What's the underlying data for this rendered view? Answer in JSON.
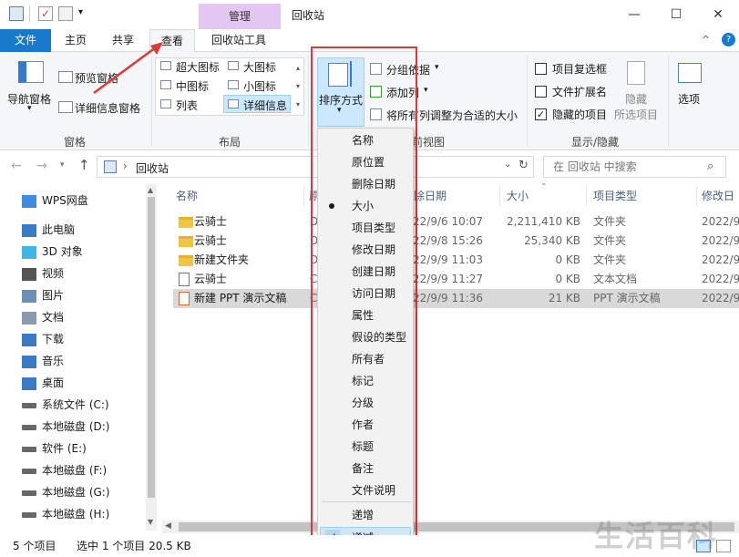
{
  "titlebar": {
    "manage_tab": "管理",
    "window_title": "回收站",
    "minimize": "—",
    "maximize": "☐",
    "close": "✕"
  },
  "tabs": {
    "file": "文件",
    "home": "主页",
    "share": "共享",
    "view": "查看",
    "recycle_tools": "回收站工具"
  },
  "ribbon": {
    "nav_pane": "导航窗格",
    "preview_pane": "预览窗格",
    "details_pane": "详细信息窗格",
    "group_panes": "窗格",
    "extra_large": "超大图标",
    "large": "大图标",
    "medium": "中图标",
    "small": "小图标",
    "list": "列表",
    "details": "详细信息",
    "group_layout": "布局",
    "sort_by": "排序方式",
    "group_by": "分组依据",
    "add_columns": "添加列",
    "size_all_columns": "将所有列调整为合适的大小",
    "group_current_view": "前视图",
    "item_checkboxes": "项目复选框",
    "file_extensions": "文件扩展名",
    "hidden_items": "隐藏的项目",
    "hide": "隐藏",
    "hide_selected": "所选项目",
    "group_show_hide": "显示/隐藏",
    "options": "选项"
  },
  "address": {
    "path": "回收站",
    "search_placeholder": "在 回收站 中搜索"
  },
  "nav_items": [
    {
      "label": "WPS网盘",
      "icon": "cloud-icon"
    },
    {
      "label": "此电脑",
      "icon": "computer-icon"
    },
    {
      "label": "3D 对象",
      "icon": "3d-objects-icon"
    },
    {
      "label": "视频",
      "icon": "video-icon"
    },
    {
      "label": "图片",
      "icon": "pictures-icon"
    },
    {
      "label": "文档",
      "icon": "documents-icon"
    },
    {
      "label": "下载",
      "icon": "download-icon"
    },
    {
      "label": "音乐",
      "icon": "music-icon"
    },
    {
      "label": "桌面",
      "icon": "desktop-icon"
    },
    {
      "label": "系统文件 (C:)",
      "icon": "drive-icon"
    },
    {
      "label": "本地磁盘 (D:)",
      "icon": "drive-icon"
    },
    {
      "label": "软件 (E:)",
      "icon": "drive-icon"
    },
    {
      "label": "本地磁盘 (F:)",
      "icon": "drive-icon"
    },
    {
      "label": "本地磁盘 (G:)",
      "icon": "drive-icon"
    },
    {
      "label": "本地磁盘 (H:)",
      "icon": "drive-icon"
    }
  ],
  "columns": {
    "name": "名称",
    "orig": "原",
    "deleted": "除日期",
    "size": "大小",
    "type": "项目类型",
    "modified": "修改日"
  },
  "files": [
    {
      "name": "云骑士",
      "orig": "D:",
      "deleted": "22/9/6 10:07",
      "size": "2,211,410 KB",
      "type": "文件夹",
      "modified": "2022/9/"
    },
    {
      "name": "云骑士",
      "orig": "D:",
      "deleted": "22/9/8 15:26",
      "size": "25,340 KB",
      "type": "文件夹",
      "modified": "2022/9/"
    },
    {
      "name": "新建文件夹",
      "orig": "D:",
      "deleted": "22/9/9 11:03",
      "size": "0 KB",
      "type": "文件夹",
      "modified": "2022/9/"
    },
    {
      "name": "云骑士",
      "orig": "C:",
      "deleted": "22/9/9 11:27",
      "size": "0 KB",
      "type": "文本文档",
      "modified": "2022/9/"
    },
    {
      "name": "新建 PPT 演示文稿",
      "orig": "C:",
      "deleted": "22/9/9 11:36",
      "size": "21 KB",
      "type": "PPT 演示文稿",
      "modified": "2022/9/"
    }
  ],
  "sort_menu": {
    "items": [
      "名称",
      "原位置",
      "删除日期",
      "大小",
      "项目类型",
      "修改日期",
      "创建日期",
      "访问日期",
      "属性",
      "假设的类型",
      "所有者",
      "标记",
      "分级",
      "作者",
      "标题",
      "备注",
      "文件说明"
    ],
    "selected": "大小",
    "ascending": "递增",
    "descending": "递减",
    "order_selected": "递减"
  },
  "status": {
    "count": "5 个项目",
    "selection": "选中 1 个项目 20.5 KB"
  },
  "watermark": "生活百科",
  "colors": {
    "accent": "#1979ca",
    "manage": "#e3c7f0",
    "highlight": "#cce8ff",
    "arrow": "#d93a3a"
  }
}
